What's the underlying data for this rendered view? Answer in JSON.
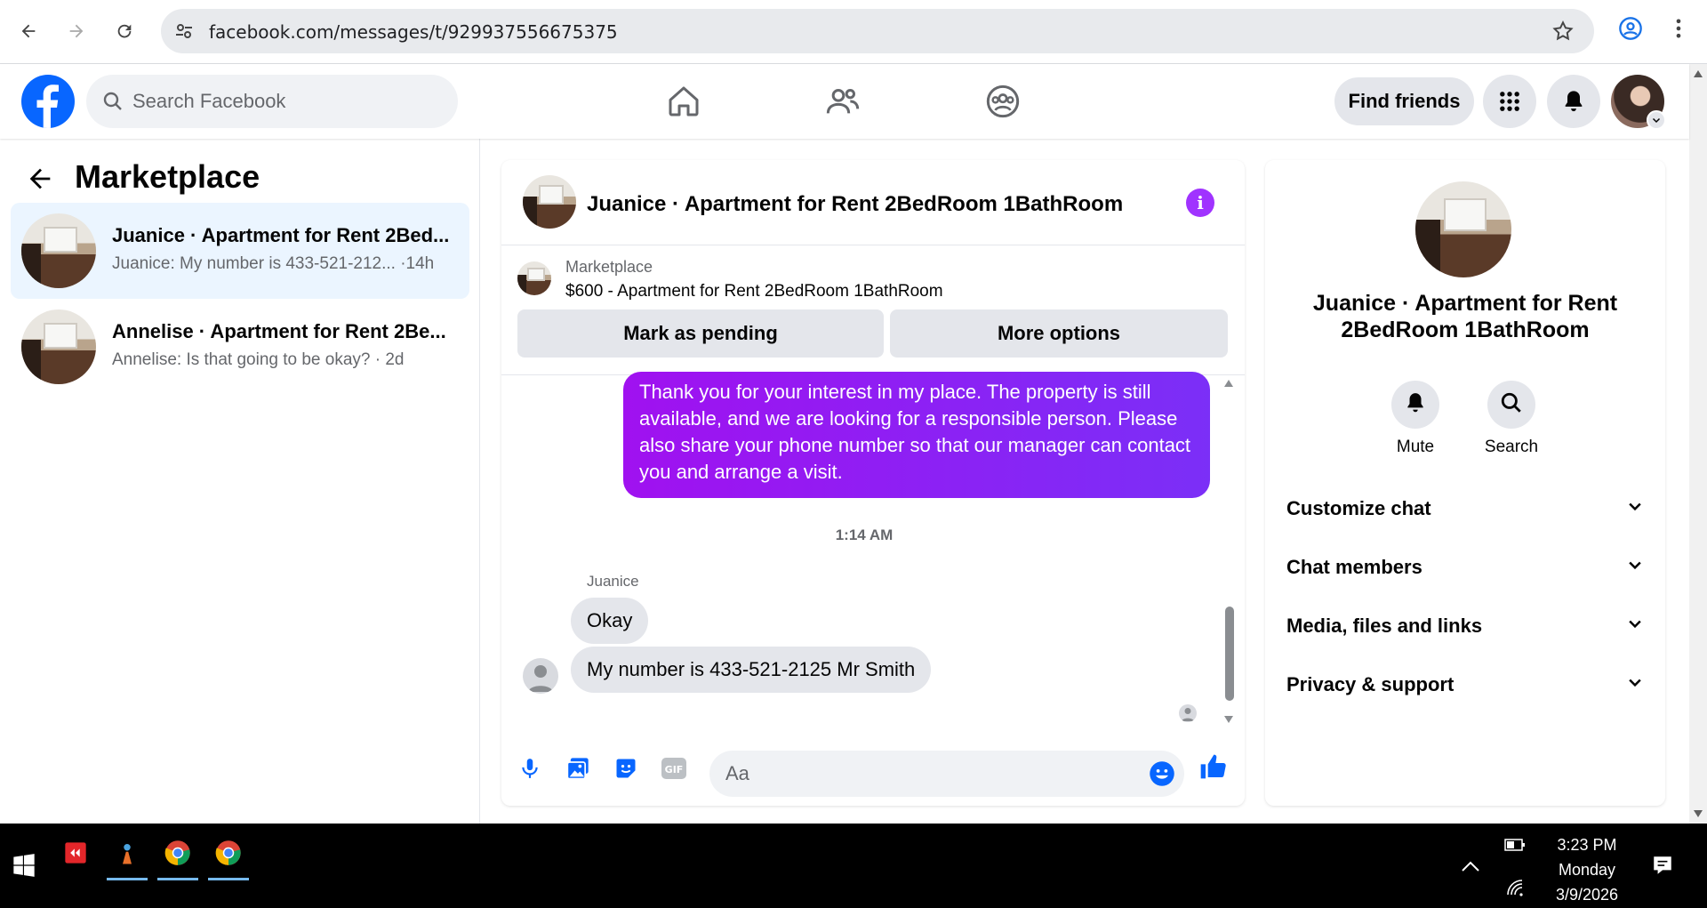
{
  "browser": {
    "url": "facebook.com/messages/t/929937556675375"
  },
  "header": {
    "search_placeholder": "Search Facebook",
    "find_friends": "Find friends"
  },
  "sidebar": {
    "title": "Marketplace",
    "conversations": [
      {
        "name": "Juanice · Apartment for Rent 2Bed...",
        "snippet": "Juanice: My number is 433-521-212...  ·14h"
      },
      {
        "name": "Annelise · Apartment for Rent 2Be...",
        "snippet": "Annelise: Is that going to be okay? · 2d"
      }
    ]
  },
  "chat": {
    "title": "Juanice · Apartment for Rent 2BedRoom 1BathRoom",
    "marketplace_label": "Marketplace",
    "listing": "$600 - Apartment for Rent 2BedRoom 1BathRoom",
    "mark_pending": "Mark as pending",
    "more_options": "More options",
    "messages": {
      "outgoing": "Thank you for your interest in my place. The property is still available, and we are looking for a responsible person. Please also share your phone number so that our manager can contact you and arrange a visit.",
      "time": "1:14 AM",
      "sender": "Juanice",
      "incoming_1": "Okay",
      "incoming_2": "My number is 433-521-2125 Mr Smith"
    },
    "composer_placeholder": "Aa"
  },
  "info_panel": {
    "title": "Juanice · Apartment for Rent 2BedRoom 1BathRoom",
    "mute": "Mute",
    "search": "Search",
    "sections": [
      "Customize chat",
      "Chat members",
      "Media, files and links",
      "Privacy & support"
    ]
  },
  "taskbar": {
    "time": "3:23 PM",
    "day": "Monday",
    "date": "3/9/2026"
  },
  "colors": {
    "brand": "#0866ff",
    "message_gradient_start": "#a011f0",
    "message_gradient_end": "#7b2ff7"
  }
}
